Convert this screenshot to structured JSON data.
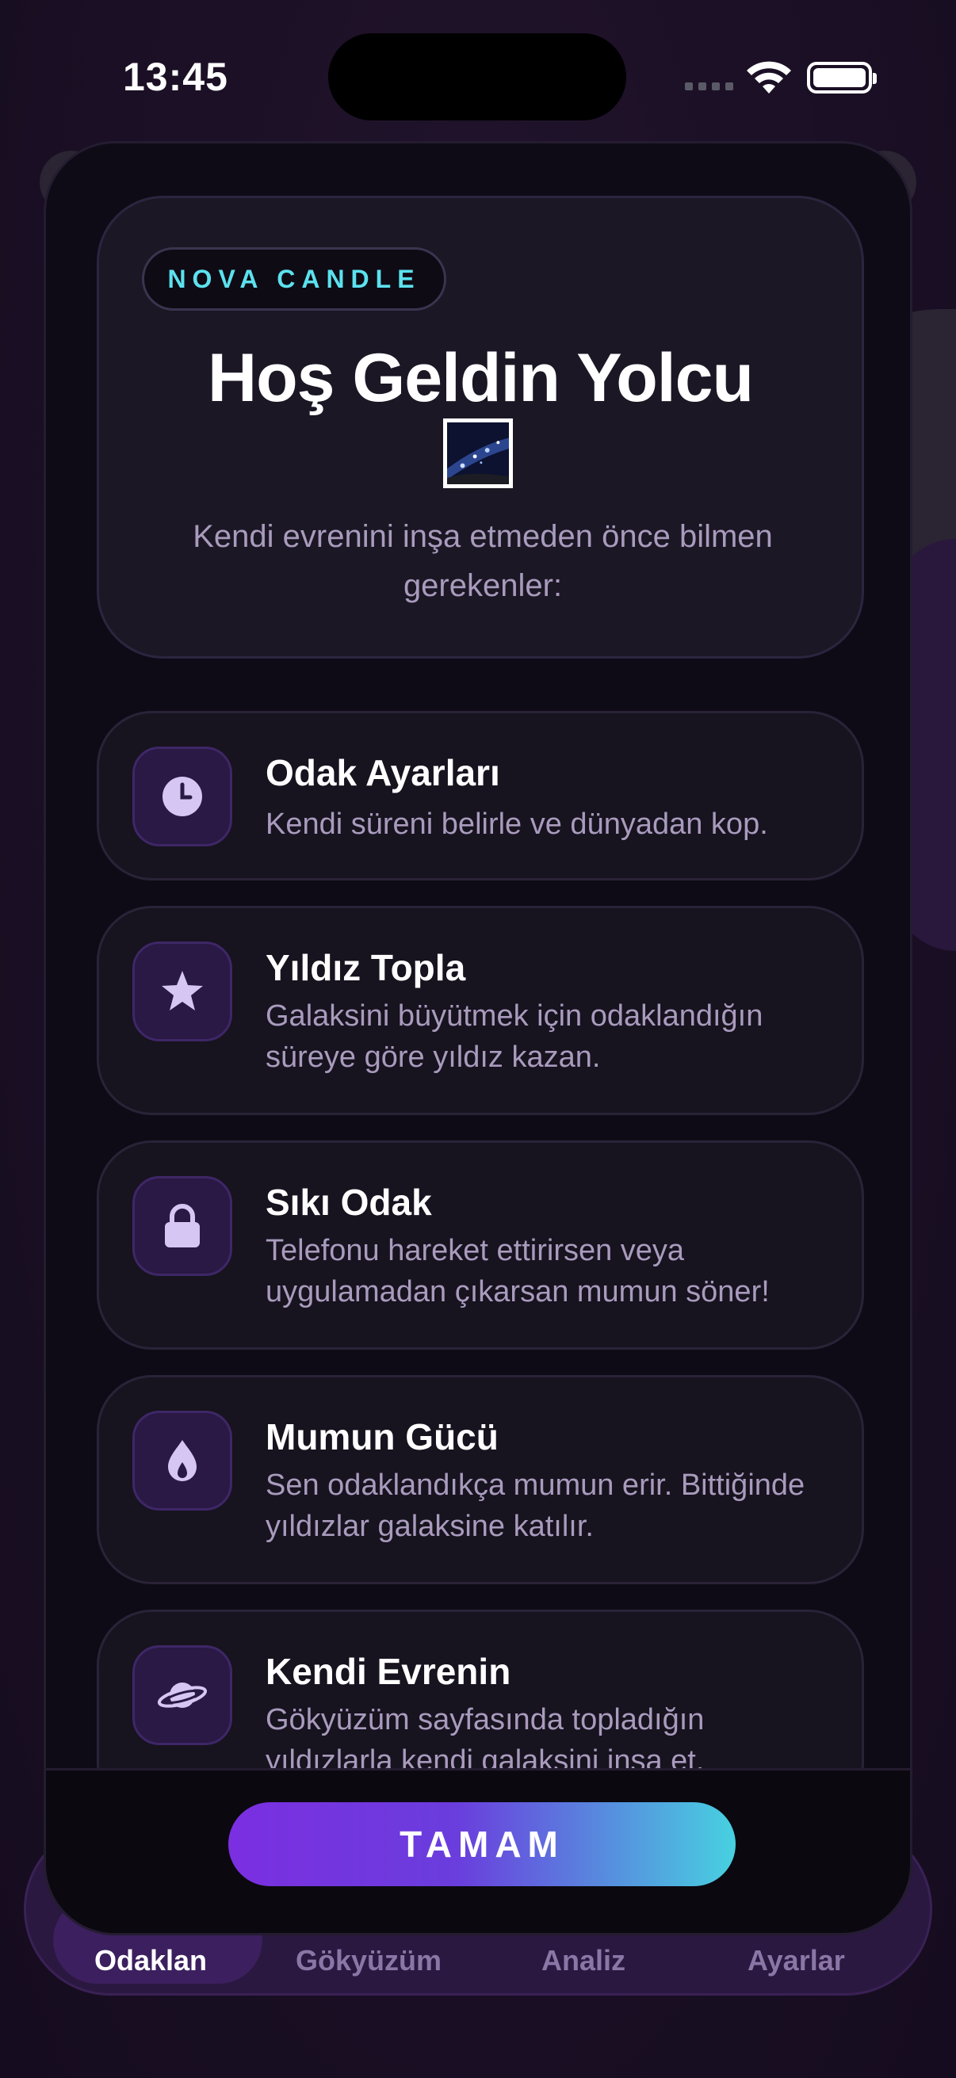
{
  "status_bar": {
    "time": "13:45"
  },
  "tabs": [
    {
      "label": "Odaklan"
    },
    {
      "label": "Gökyüzüm"
    },
    {
      "label": "Analiz"
    },
    {
      "label": "Ayarlar"
    }
  ],
  "modal": {
    "badge": "NOVA CANDLE",
    "title": "Hoş Geldin Yolcu",
    "subtitle": "Kendi evrenini inşa etmeden önce bilmen gerekenler:",
    "features": [
      {
        "icon": "clock-icon",
        "title": "Odak Ayarları",
        "desc": "Kendi süreni belirle ve dünyadan kop."
      },
      {
        "icon": "star-icon",
        "title": "Yıldız Topla",
        "desc": "Galaksini büyütmek için odaklandığın süreye göre yıldız kazan."
      },
      {
        "icon": "lock-icon",
        "title": "Sıkı Odak",
        "desc": "Telefonu hareket ettirirsen veya uygulamadan çıkarsan mumun söner!"
      },
      {
        "icon": "flame-icon",
        "title": "Mumun Gücü",
        "desc": "Sen odaklandıkça mumun erir. Bittiğinde yıldızlar galaksine katılır."
      },
      {
        "icon": "planet-icon",
        "title": "Kendi Evrenin",
        "desc": "Gökyüzüm sayfasında topladığın yıldızlarla kendi galaksini inşa et."
      }
    ],
    "ok_label": "TAMAM"
  }
}
